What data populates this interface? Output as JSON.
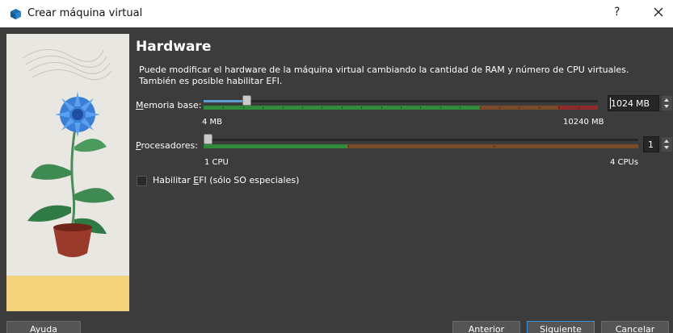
{
  "window": {
    "title": "Crear máquina virtual",
    "help_label": "?"
  },
  "page": {
    "heading": "Hardware",
    "description_line1": "Puede modificar el hardware de la máquina virtual cambiando la cantidad de RAM y número de CPU virtuales.",
    "description_line2": "También es posible habilitar EFI."
  },
  "memory": {
    "label_mnemonic": "M",
    "label_rest": "emoria base:",
    "value": "1024",
    "unit": "MB",
    "min_label": "4 MB",
    "max_label": "10240 MB",
    "level_fraction": 0.1
  },
  "processors": {
    "label_mnemonic": "P",
    "label_rest": "rocesadores:",
    "value": "1",
    "min_label": "1 CPU",
    "max_label": "4 CPUs",
    "level_fraction": 0
  },
  "efi": {
    "label_pre": "Habilitar ",
    "label_mnemonic": "E",
    "label_post": "FI (sólo SO especiales)",
    "checked": false
  },
  "buttons": {
    "help": "Ayuda",
    "back": "Anterior",
    "next": "Siguiente",
    "cancel": "Cancelar"
  },
  "colors": {
    "zone_ok": "#2f8a3a",
    "zone_warn": "#7a4a2a",
    "zone_danger": "#8e2a2a",
    "accent": "#3a8ed6",
    "slider_fill": "#5a9fd4"
  },
  "icons": {
    "app": "virtualbox-cube-icon",
    "close": "close-icon",
    "illustration": "flower-pot-illustration"
  }
}
